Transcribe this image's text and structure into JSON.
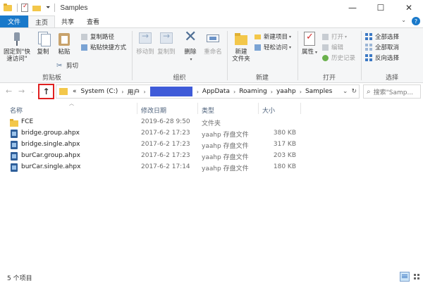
{
  "window": {
    "title": "Samples",
    "buttons": [
      "—",
      "☐",
      "✕"
    ]
  },
  "tabs": [
    {
      "label": "文件",
      "kind": "file"
    },
    {
      "label": "主页",
      "kind": "active"
    },
    {
      "label": "共享",
      "kind": ""
    },
    {
      "label": "查看",
      "kind": ""
    }
  ],
  "ribbon": {
    "clipboard": {
      "label": "剪贴板",
      "pin_label": "固定到\"快速访问\"",
      "copy_label": "复制",
      "paste_label": "粘贴",
      "copy_path": "复制路径",
      "paste_shortcut": "粘贴快捷方式",
      "cut": "剪切"
    },
    "organize": {
      "label": "组织",
      "move_to": "移动到",
      "copy_to": "复制到",
      "delete": "删除",
      "rename": "重命名"
    },
    "new": {
      "label": "新建",
      "new_item": "新建项目",
      "easy_access": "轻松访问",
      "new_folder": "新建\n文件夹"
    },
    "open": {
      "label": "打开",
      "properties": "属性",
      "open": "打开",
      "edit": "编辑",
      "history": "历史记录"
    },
    "select": {
      "label": "选择",
      "select_all": "全部选择",
      "select_none": "全部取消",
      "invert": "反向选择"
    }
  },
  "address": {
    "prefix": "«",
    "crumbs_before": [
      "System (C:)",
      "用户"
    ],
    "crumbs_after": [
      "AppData",
      "Roaming",
      "yaahp",
      "Samples"
    ],
    "dropdown": "⌄",
    "refresh": "↻"
  },
  "search": {
    "placeholder": "搜索\"Samp..."
  },
  "columns": {
    "name": "名称",
    "modified": "修改日期",
    "type": "类型",
    "size": "大小"
  },
  "files": [
    {
      "name": "FCE",
      "modified": "2019-6-28 9:50",
      "type": "文件夹",
      "size": "",
      "kind": "folder"
    },
    {
      "name": "bridge.group.ahpx",
      "modified": "2017-6-2 17:23",
      "type": "yaahp 存盘文件",
      "size": "380 KB",
      "kind": "ahp"
    },
    {
      "name": "bridge.single.ahpx",
      "modified": "2017-6-2 17:23",
      "type": "yaahp 存盘文件",
      "size": "317 KB",
      "kind": "ahp"
    },
    {
      "name": "burCar.group.ahpx",
      "modified": "2017-6-2 17:23",
      "type": "yaahp 存盘文件",
      "size": "203 KB",
      "kind": "ahp"
    },
    {
      "name": "burCar.single.ahpx",
      "modified": "2017-6-2 17:14",
      "type": "yaahp 存盘文件",
      "size": "180 KB",
      "kind": "ahp"
    }
  ],
  "status": {
    "count": "5 个项目"
  }
}
